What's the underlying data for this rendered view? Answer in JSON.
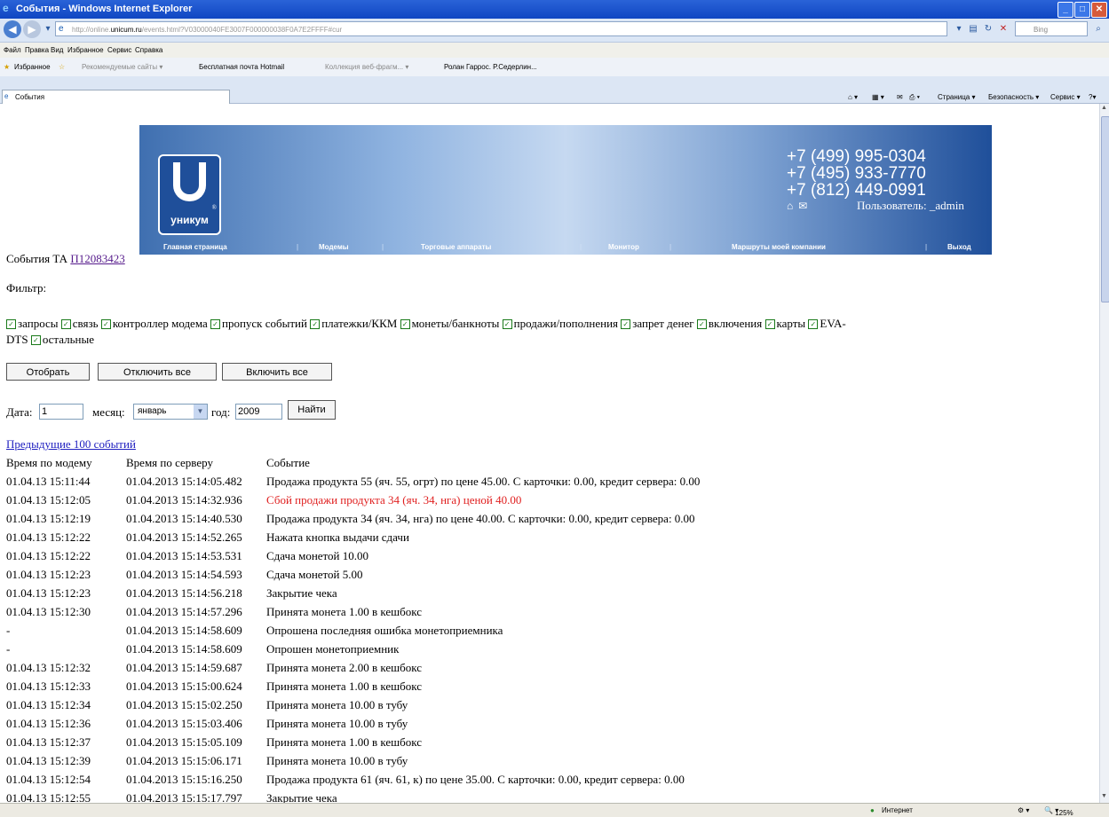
{
  "window": {
    "title": "События - Windows Internet Explorer",
    "url_prefix": "http://online.",
    "url_domain": "unicum.ru",
    "url_rest": "/events.html?V03000040FE3007F000000038F0A7E2FFFF#cur",
    "search_placeholder": "Bing"
  },
  "menu": [
    "Файл",
    "Правка",
    "Вид",
    "Избранное",
    "Сервис",
    "Справка"
  ],
  "favorites": {
    "label": "Избранное",
    "items": [
      "Рекомендуемые сайты ▾",
      "Бесплатная почта Hotmail",
      "Коллекция веб-фрагм... ▾",
      "Ролан Гаррос. Р.Седерлин..."
    ]
  },
  "tab": {
    "title": "События"
  },
  "commands": {
    "page": "Страница ▾",
    "security": "Безопасность ▾",
    "service": "Сервис ▾"
  },
  "status": {
    "zone": "Интернет",
    "zoom": "125%"
  },
  "banner": {
    "logo_text": "уникум",
    "phones": [
      "+7 (499) 995-0304",
      "+7 (495) 933-7770",
      "+7 (812) 449-0991"
    ],
    "user_label": "Пользователь:",
    "user_name": "_admin",
    "nav": [
      "Главная страница",
      "Модемы",
      "Торговые аппараты",
      "Монитор",
      "Маршруты моей компании",
      "Выход"
    ]
  },
  "page": {
    "heading_prefix": "События ТА",
    "machine_id": "П12083423",
    "filter_label": "Фильтр:",
    "filters": [
      "запросы",
      "связь",
      "контроллер модема",
      "пропуск событий",
      "платежки/ККМ",
      "монеты/банкноты",
      "продажи/пополнения",
      "запрет денег",
      "включения",
      "карты",
      "EVA-"
    ],
    "filters_line2": [
      "DTS",
      "остальные"
    ],
    "btn_show": "Отобрать",
    "btn_disable_all": "Отключить все",
    "btn_enable_all": "Включить все",
    "date_label": "Дата:",
    "date_value": "1",
    "month_label": "месяц:",
    "month_value": "январь",
    "year_label": "год:",
    "year_value": "2009",
    "btn_find": "Найти",
    "prev_link": "Предыдущие 100 событий",
    "col_modem": "Время по модему",
    "col_server": "Время по серверу",
    "col_event": "Событие"
  },
  "events": [
    {
      "modem": "01.04.13 15:11:44",
      "server": "01.04.2013 15:14:05.482",
      "text": "Продажа продукта 55 (яч. 55, огрт) по цене 45.00. С карточки: 0.00, кредит сервера: 0.00"
    },
    {
      "modem": "01.04.13 15:12:05",
      "server": "01.04.2013 15:14:32.936",
      "text": "Сбой продажи продукта 34 (яч. 34, нга) ценой 40.00",
      "alert": true
    },
    {
      "modem": "01.04.13 15:12:19",
      "server": "01.04.2013 15:14:40.530",
      "text": "Продажа продукта 34 (яч. 34, нга) по цене 40.00. С карточки: 0.00, кредит сервера: 0.00"
    },
    {
      "modem": "01.04.13 15:12:22",
      "server": "01.04.2013 15:14:52.265",
      "text": "Нажата кнопка выдачи сдачи"
    },
    {
      "modem": "01.04.13 15:12:22",
      "server": "01.04.2013 15:14:53.531",
      "text": "Сдача монетой 10.00"
    },
    {
      "modem": "01.04.13 15:12:23",
      "server": "01.04.2013 15:14:54.593",
      "text": "Сдача монетой 5.00"
    },
    {
      "modem": "01.04.13 15:12:23",
      "server": "01.04.2013 15:14:56.218",
      "text": "Закрытие чека"
    },
    {
      "modem": "01.04.13 15:12:30",
      "server": "01.04.2013 15:14:57.296",
      "text": "Принята монета 1.00 в кешбокс"
    },
    {
      "modem": "-",
      "server": "01.04.2013 15:14:58.609",
      "text": "Опрошена последняя ошибка монетоприемника"
    },
    {
      "modem": "-",
      "server": "01.04.2013 15:14:58.609",
      "text": "Опрошен монетоприемник"
    },
    {
      "modem": "01.04.13 15:12:32",
      "server": "01.04.2013 15:14:59.687",
      "text": "Принята монета 2.00 в кешбокс"
    },
    {
      "modem": "01.04.13 15:12:33",
      "server": "01.04.2013 15:15:00.624",
      "text": "Принята монета 1.00 в кешбокс"
    },
    {
      "modem": "01.04.13 15:12:34",
      "server": "01.04.2013 15:15:02.250",
      "text": "Принята монета 10.00 в тубу"
    },
    {
      "modem": "01.04.13 15:12:36",
      "server": "01.04.2013 15:15:03.406",
      "text": "Принята монета 10.00 в тубу"
    },
    {
      "modem": "01.04.13 15:12:37",
      "server": "01.04.2013 15:15:05.109",
      "text": "Принята монета 1.00 в кешбокс"
    },
    {
      "modem": "01.04.13 15:12:39",
      "server": "01.04.2013 15:15:06.171",
      "text": "Принята монета 10.00 в тубу"
    },
    {
      "modem": "01.04.13 15:12:54",
      "server": "01.04.2013 15:15:16.250",
      "text": "Продажа продукта 61 (яч. 61, к) по цене 35.00. С карточки: 0.00, кредит сервера: 0.00"
    },
    {
      "modem": "01.04.13 15:12:55",
      "server": "01.04.2013 15:15:17.797",
      "text": "Закрытие чека"
    }
  ]
}
